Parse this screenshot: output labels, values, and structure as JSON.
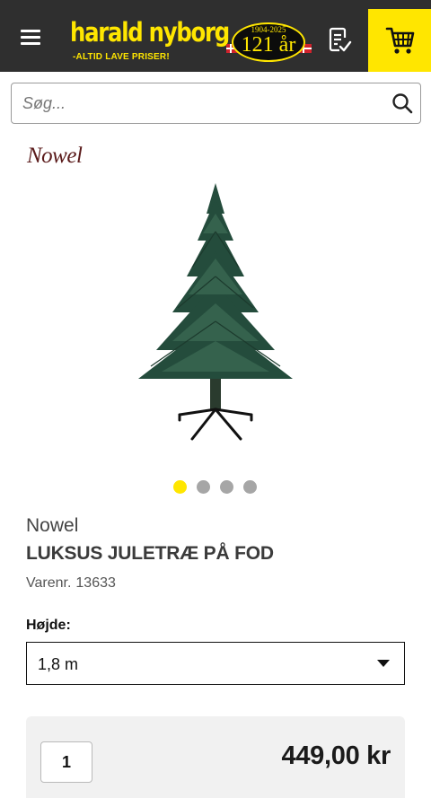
{
  "header": {
    "logo_name": "harald nyborg",
    "logo_tagline": "-ALTID LAVE PRISER!",
    "anniversary_years": "1904-2025",
    "anniversary_count": "121 år",
    "icons": {
      "menu": "hamburger-menu-icon",
      "wishlist": "checklist-icon",
      "cart": "shopping-cart-icon"
    },
    "colors": {
      "bar": "#2f2f2f",
      "accent": "#ffe600"
    }
  },
  "search": {
    "placeholder": "Søg...",
    "icon": "search-icon"
  },
  "product": {
    "brand_logo": "Nowel",
    "gallery": {
      "image_count": 4,
      "active_index": 0
    },
    "brand": "Nowel",
    "title": "LUKSUS JULETRÆ PÅ FOD",
    "sku_label": "Varenr.",
    "sku": "13633",
    "height_label": "Højde:",
    "height_selected": "1,8 m",
    "quantity": "1",
    "price": "449,00 kr"
  }
}
